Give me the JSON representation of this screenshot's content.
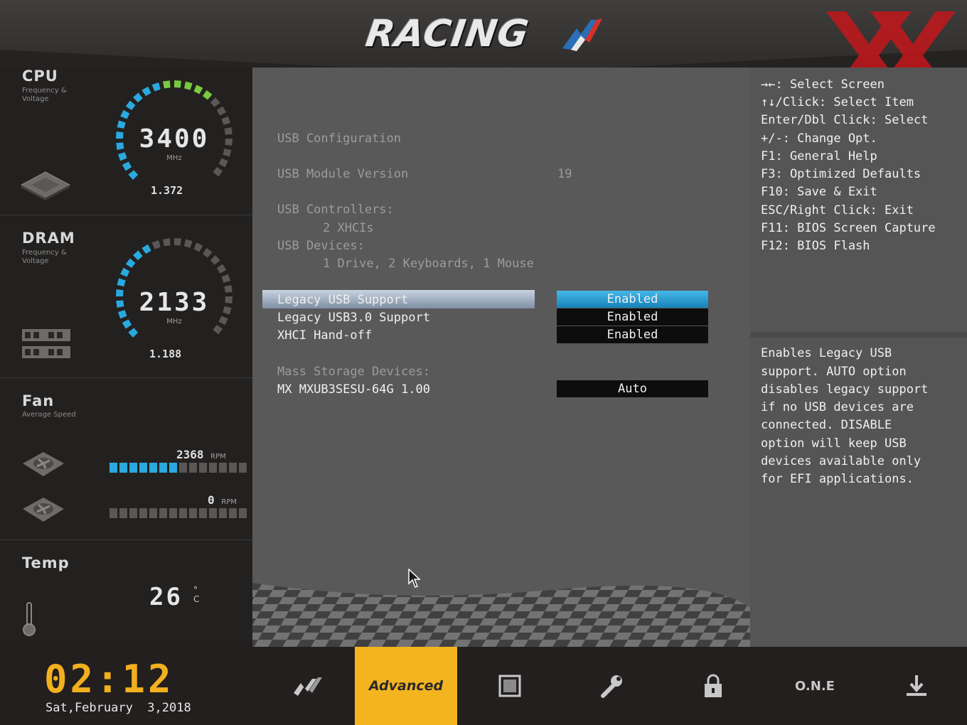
{
  "header": {
    "logo_text": "RACING"
  },
  "sidebar": {
    "cpu": {
      "title": "CPU",
      "subtitle": "Frequency & Voltage",
      "frequency": "3400",
      "unit": "MHz",
      "voltage": "1.372"
    },
    "dram": {
      "title": "DRAM",
      "subtitle": "Frequency & Voltage",
      "frequency": "2133",
      "unit": "MHz",
      "voltage": "1.188"
    },
    "fan": {
      "title": "Fan",
      "subtitle": "Average Speed",
      "fans": [
        {
          "rpm": "2368",
          "unit": "RPM",
          "level": 0.5
        },
        {
          "rpm": "0",
          "unit": "RPM",
          "level": 0
        }
      ]
    },
    "temp": {
      "title": "Temp",
      "value": "26",
      "unit": "°C"
    }
  },
  "main": {
    "usb_config_label": "USB Configuration",
    "module_version_label": "USB Module Version",
    "module_version_value": "19",
    "controllers_label": "USB Controllers:",
    "controllers_value": "2 XHCIs",
    "devices_label": "USB Devices:",
    "devices_value": "1 Drive, 2 Keyboards, 1 Mouse",
    "settings": [
      {
        "label": "Legacy USB Support",
        "value": "Enabled"
      },
      {
        "label": "Legacy USB3.0 Support",
        "value": "Enabled"
      },
      {
        "label": "XHCI Hand-off",
        "value": "Enabled"
      }
    ],
    "mass_storage_label": "Mass Storage Devices:",
    "mass_storage_device": "MX MXUB3SESU-64G 1.00",
    "mass_storage_value": "Auto"
  },
  "help": {
    "keys": [
      "→←: Select Screen",
      "↑↓/Click: Select Item",
      "Enter/Dbl Click: Select",
      "+/-: Change Opt.",
      "F1: General Help",
      "F3: Optimized Defaults",
      "F10: Save & Exit",
      "ESC/Right Click: Exit",
      "F11: BIOS Screen Capture",
      "F12: BIOS Flash"
    ],
    "description": [
      "Enables Legacy USB",
      "support. AUTO option",
      "disables legacy support",
      "if no USB devices are",
      "connected. DISABLE",
      "option will keep USB",
      "devices available only",
      "for EFI applications."
    ]
  },
  "bottom": {
    "clock": "02:12",
    "date": "Sat,February  3,2018",
    "nav": {
      "advanced": "Advanced",
      "one": "O.N.E"
    }
  },
  "colors": {
    "accent": "#f4b41f",
    "highlight": "#2aa9df",
    "gauge_green": "#7ac943"
  }
}
